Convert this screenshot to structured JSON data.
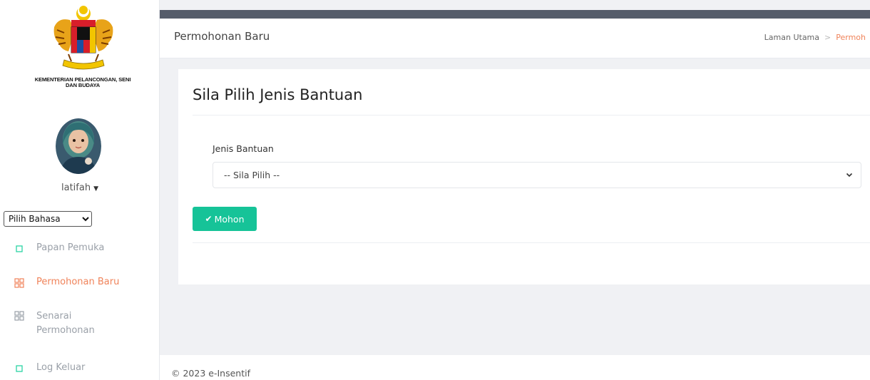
{
  "sidebar": {
    "ministry_name": "KEMENTERIAN PELANCONGAN, SENI DAN BUDAYA",
    "user_name": "latifah",
    "language_select": {
      "selected": "Pilih Bahasa"
    },
    "nav": [
      {
        "label": "Papan Pemuka",
        "icon": "square-icon"
      },
      {
        "label": "Permohonan Baru",
        "icon": "grid-icon",
        "active": true
      },
      {
        "label_line1": "Senarai",
        "label_line2": "Permohonan",
        "icon": "grid-icon"
      },
      {
        "label": "Log Keluar",
        "icon": "square-icon"
      }
    ]
  },
  "header": {
    "title": "Permohonan Baru",
    "breadcrumb": {
      "home": "Laman Utama",
      "current": "Permoh"
    }
  },
  "card": {
    "title": "Sila Pilih Jenis Bantuan",
    "field_label": "Jenis Bantuan",
    "select_value": "-- Sila Pilih --",
    "submit_label": "Mohon"
  },
  "footer": {
    "text": "© 2023 e-Insentif"
  },
  "colors": {
    "accent": "#f0835a",
    "submit": "#16c398",
    "topbar": "#555c6a",
    "nav_inactive": "#9aa0a8",
    "nav_square": "#2bd4a4"
  }
}
